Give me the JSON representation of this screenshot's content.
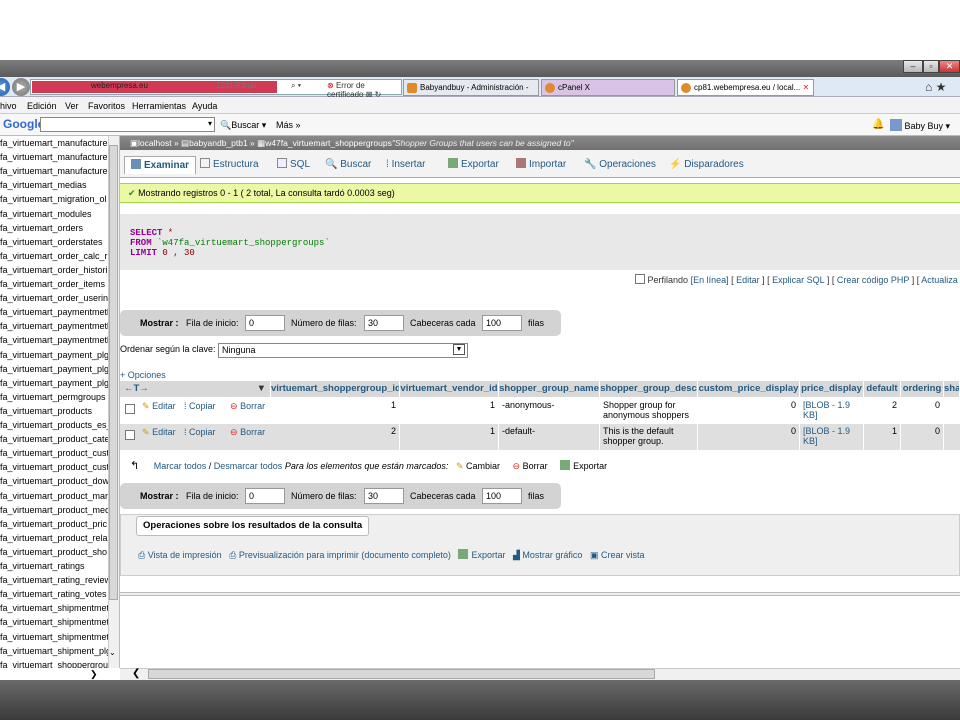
{
  "browser": {
    "address_url": "webempresa.eu",
    "address_rest": "12319/3rdp",
    "address_controls": "⌕ ▾",
    "cert_error": "Error de certificado",
    "tabs": [
      {
        "label": "Babyandbuy - Administración -",
        "color": "#e08a2b"
      },
      {
        "label": "cPanel X",
        "color": "#e08a2b"
      },
      {
        "label": "cp81.webempresa.eu / local...",
        "color": "#e08a2b",
        "close": "✕"
      }
    ],
    "menu": [
      "hivo",
      "Edición",
      "Ver",
      "Favoritos",
      "Herramientas",
      "Ayuda"
    ],
    "google_label": "Google",
    "buscar": "Buscar ▾",
    "mas": "Más »",
    "user": "Baby Buy ▾"
  },
  "sidebar": {
    "items": [
      "fa_virtuemart_manufacture",
      "fa_virtuemart_manufacture",
      "fa_virtuemart_manufacture",
      "fa_virtuemart_medias",
      "fa_virtuemart_migration_ol",
      "fa_virtuemart_modules",
      "fa_virtuemart_orders",
      "fa_virtuemart_orderstates",
      "fa_virtuemart_order_calc_r",
      "fa_virtuemart_order_histori",
      "fa_virtuemart_order_items",
      "fa_virtuemart_order_userin",
      "fa_virtuemart_paymentmetl",
      "fa_virtuemart_paymentmetl",
      "fa_virtuemart_paymentmetl",
      "fa_virtuemart_payment_plg",
      "fa_virtuemart_payment_plg",
      "fa_virtuemart_payment_plg",
      "fa_virtuemart_permgroups",
      "fa_virtuemart_products",
      "fa_virtuemart_products_es_",
      "fa_virtuemart_product_cate",
      "fa_virtuemart_product_cust",
      "fa_virtuemart_product_cust",
      "fa_virtuemart_product_dow",
      "fa_virtuemart_product_mar",
      "fa_virtuemart_product_mec",
      "fa_virtuemart_product_pric",
      "fa_virtuemart_product_rela",
      "fa_virtuemart_product_sho",
      "fa_virtuemart_ratings",
      "fa_virtuemart_rating_review",
      "fa_virtuemart_rating_votes",
      "fa_virtuemart_shipmentmet",
      "fa_virtuemart_shipmentmet",
      "fa_virtuemart_shipmentmet",
      "fa_virtuemart_shipment_plg",
      "fa_virtuemart_shoppergrou"
    ]
  },
  "breadcrumb": {
    "server": "localhost »",
    "db": "babyandb_ptb1 »",
    "table": "w47fa_virtuemart_shoppergroups",
    "comment": "\"Shopper Groups that users can be assigned to\""
  },
  "tabs": [
    "Examinar",
    "Estructura",
    "SQL",
    "Buscar",
    "Insertar",
    "Exportar",
    "Importar",
    "Operaciones",
    "Disparadores"
  ],
  "notice": "Mostrando registros 0 - 1 ( 2 total, La consulta tardó 0.0003 seg)",
  "sql": {
    "select": "SELECT",
    "star": " *",
    "from": "FROM",
    "table": " `w47fa_virtuemart_shoppergroups`",
    "limit": "LIMIT",
    "limit_val": " 0 , 30"
  },
  "sqllinks": {
    "profiling": "Perfilando",
    "enlinea": "[En línea]",
    "editar": "Editar",
    "explicar": "Explicar SQL",
    "crear": "Crear código PHP",
    "actualizar": "Actualiza"
  },
  "nav": {
    "mostrar": "Mostrar :",
    "fila_inicio": "Fila de inicio:",
    "fila_val": "0",
    "num_filas": "Número de filas:",
    "num_val": "30",
    "cabeceras": "Cabeceras cada",
    "cab_val": "100",
    "filas": "filas"
  },
  "orden": {
    "label": "Ordenar según la clave:",
    "value": "Ninguna"
  },
  "opciones": "+ Opciones",
  "table": {
    "sort_arrows": "←T→",
    "columns": [
      "virtuemart_shoppergroup_id",
      "virtuemart_vendor_id",
      "shopper_group_name",
      "shopper_group_desc",
      "custom_price_display",
      "price_display",
      "default",
      "ordering",
      "sha"
    ],
    "rows": [
      {
        "id": "1",
        "vendor": "1",
        "name": "-anonymous-",
        "desc": "Shopper group for anonymous shoppers",
        "custom": "0",
        "price": "[BLOB - 1.9 KB]",
        "default": "2",
        "ordering": "0"
      },
      {
        "id": "2",
        "vendor": "1",
        "name": "-default-",
        "desc": "This is the default shopper group.",
        "custom": "0",
        "price": "[BLOB - 1.9 KB]",
        "default": "1",
        "ordering": "0"
      }
    ],
    "actions": {
      "editar": "Editar",
      "copiar": "Copiar",
      "borrar": "Borrar"
    }
  },
  "bulk": {
    "marcar": "Marcar todos",
    "sep": " / ",
    "desmarcar": "Desmarcar todos",
    "para": "Para los elementos que están marcados:",
    "cambiar": "Cambiar",
    "borrar": "Borrar",
    "exportar": "Exportar"
  },
  "ops": {
    "title": "Operaciones sobre los resultados de la consulta",
    "vista": "Vista de impresión",
    "previsual": "Previsualización para imprimir (documento completo)",
    "exportar": "Exportar",
    "grafico": "Mostrar gráfico",
    "crear": "Crear vista"
  },
  "colors": {
    "link": "#235a81",
    "notice_bg": "#ebf8a4",
    "keyword": "#990099",
    "table_name": "#008000"
  }
}
